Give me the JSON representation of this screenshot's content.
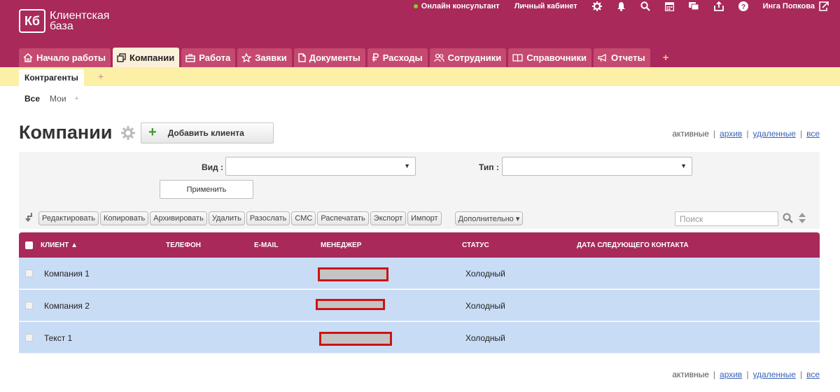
{
  "header": {
    "logo_mark": "Кб",
    "logo_line1": "Клиентская",
    "logo_line2": "база",
    "online": "Онлайн консультант",
    "cabinet": "Личный кабинет",
    "user": "Инга Попкова"
  },
  "tabs": [
    {
      "label": "Начало работы",
      "icon": "home-icon"
    },
    {
      "label": "Компании",
      "icon": "copy-icon",
      "active": true
    },
    {
      "label": "Работа",
      "icon": "briefcase-icon"
    },
    {
      "label": "Заявки",
      "icon": "star-icon"
    },
    {
      "label": "Документы",
      "icon": "document-icon"
    },
    {
      "label": "Расходы",
      "icon": "ruble-icon"
    },
    {
      "label": "Сотрудники",
      "icon": "people-icon"
    },
    {
      "label": "Справочники",
      "icon": "book-icon"
    },
    {
      "label": "Отчеты",
      "icon": "megaphone-icon"
    }
  ],
  "tab_add": "+",
  "subtabs": {
    "active": "Контрагенты",
    "add": "+"
  },
  "filters": {
    "all": "Все",
    "mine": "Мои",
    "add": "+"
  },
  "page": {
    "title": "Компании",
    "add_button": "Добавить клиента"
  },
  "status_links": {
    "active": "активные",
    "archive": "архив",
    "deleted": "удаленные",
    "all": "все"
  },
  "filter_panel": {
    "view_label": "Вид :",
    "view_value": "",
    "type_label": "Тип :",
    "type_value": "",
    "apply": "Применить"
  },
  "toolbar": {
    "buttons": [
      "Редактировать",
      "Копировать",
      "Архивировать",
      "Удалить",
      "Разослать",
      "СМС",
      "Распечатать",
      "Экспорт",
      "Импорт"
    ],
    "more": "Дополнительно ▾",
    "search_placeholder": "Поиск"
  },
  "table": {
    "columns": [
      "КЛИЕНТ ▲",
      "ТЕЛЕФОН",
      "E-MAIL",
      "МЕНЕДЖЕР",
      "СТАТУС",
      "ДАТА СЛЕДУЮЩЕГО КОНТАКТА"
    ],
    "rows": [
      {
        "client": "Компания 1",
        "phone": "",
        "email": "",
        "status": "Холодный",
        "next_contact": ""
      },
      {
        "client": "Компания 2",
        "phone": "",
        "email": "",
        "status": "Холодный",
        "next_contact": ""
      },
      {
        "client": "Текст 1",
        "phone": "",
        "email": "",
        "status": "Холодный",
        "next_contact": ""
      }
    ]
  },
  "colors": {
    "brand": "#a8295a",
    "tab": "#c64a70",
    "row": "#c9dcf5",
    "subbar": "#fbf0a6"
  }
}
